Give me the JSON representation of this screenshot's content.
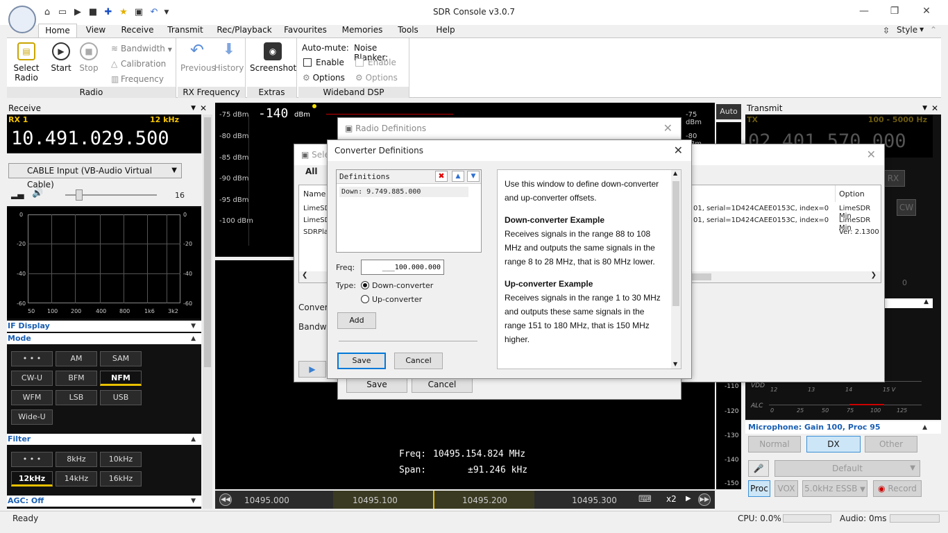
{
  "app": {
    "title": "SDR Console v3.0.7",
    "window_controls": [
      "—",
      "❐",
      "✕"
    ]
  },
  "ribbon": {
    "tabs": [
      "Home",
      "View",
      "Receive",
      "Transmit",
      "Rec/Playback",
      "Favourites",
      "Memories",
      "Tools",
      "Help"
    ],
    "active_tab": "Home",
    "style_label": "Style",
    "radio_group": {
      "label": "Radio",
      "select_radio": "Select Radio",
      "start": "Start",
      "stop": "Stop",
      "bandwidth": "Bandwidth",
      "calibration": "Calibration",
      "frequency": "Frequency"
    },
    "rx_frequency_group": {
      "label": "RX Frequency",
      "previous": "Previous",
      "history": "History"
    },
    "extras_group": {
      "label": "Extras",
      "screenshot": "Screenshot"
    },
    "wideband_group": {
      "label": "Wideband DSP",
      "auto_mute": "Auto-mute:",
      "noise_blanker": "Noise Blanker:",
      "enable": "Enable",
      "options": "Options"
    }
  },
  "receive": {
    "header": "Receive",
    "rx_label": "RX 1",
    "bandwidth": "12 kHz",
    "frequency": "10.491.029.500",
    "audio_device": "CABLE Input (VB-Audio Virtual Cable)",
    "volume_value": "16",
    "volume_level": 0.15,
    "graph_y_left": [
      "0",
      "-20",
      "-40",
      "-60"
    ],
    "graph_y_right": [
      "0",
      "-20",
      "-40",
      "-60"
    ],
    "graph_x": [
      "50",
      "100",
      "200",
      "400",
      "800",
      "1k6",
      "3k2"
    ],
    "if_display": "IF Display",
    "mode_header": "Mode",
    "modes": [
      "• • •",
      "AM",
      "SAM",
      "CW-U",
      "BFM",
      "NFM",
      "WFM",
      "LSB",
      "USB",
      "Wide-U"
    ],
    "active_mode": "NFM",
    "filter_header": "Filter",
    "filters": [
      "• • •",
      "8kHz",
      "10kHz",
      "12kHz",
      "14kHz",
      "16kHz"
    ],
    "active_filter": "12kHz",
    "agc": "AGC: Off"
  },
  "spectrum": {
    "level": "-140",
    "level_unit": "dBm",
    "dbm_left": [
      "-75 dBm",
      "-80 dBm",
      "-85 dBm",
      "-90 dBm",
      "-95 dBm",
      "-100 dBm"
    ],
    "dbm_right": [
      "-75 dBm",
      "-80 dBm"
    ],
    "auto": "Auto",
    "right_scale": [
      "-110",
      "-120",
      "-130",
      "-140",
      "-150"
    ],
    "freq_readout_label": "Freq:",
    "freq_readout": "10495.154.824 MHz",
    "span_label": "Span:",
    "span_readout": "±91.246 kHz",
    "scale_labels": [
      "10495.000",
      "10495.100",
      "10495.200",
      "10495.300"
    ],
    "zoom": "x2"
  },
  "transmit": {
    "header": "Transmit",
    "tx_label": "TX",
    "range": "100 - 5000 Hz",
    "frequency": "02.401.570.000",
    "rx_btn": "RX",
    "cw_btn": "CW",
    "meter_zero": "0",
    "vdd_label": "VDD",
    "vdd_scale": [
      "12",
      "13",
      "14",
      "15 V"
    ],
    "alc_label": "ALC",
    "alc_scale": [
      "0",
      "25",
      "50",
      "75",
      "100",
      "125"
    ],
    "mic_header": "Microphone: Gain 100, Proc 95",
    "mic_modes": [
      "Normal",
      "DX",
      "Other"
    ],
    "active_mic_mode": "DX",
    "default": "Default",
    "proc": "Proc",
    "vox": "VOX",
    "essb": "5.0kHz ESSB",
    "record": "Record"
  },
  "status": {
    "ready": "Ready",
    "cpu": "CPU: 0.0%",
    "audio": "Audio: 0ms"
  },
  "select_dialog": {
    "title": "Sele",
    "tab_all": "All",
    "col_name": "Name",
    "col_option": "Option",
    "rows": [
      {
        "name": "LimeSDR",
        "detail": "01, serial=1D424CAEE0153C, index=0",
        "option": "LimeSDR Min"
      },
      {
        "name": "LimeSDR",
        "detail": "01, serial=1D424CAEE0153C, index=0",
        "option": "LimeSDR Min"
      },
      {
        "name": "SDRPla",
        "detail": "",
        "option": "Ver: 2.1300"
      }
    ],
    "converter_label": "Converte",
    "bandwidth_label": "Bandwidt"
  },
  "radio_dialog": {
    "title": "Radio Definitions",
    "save": "Save",
    "cancel": "Cancel"
  },
  "converter_dialog": {
    "title": "Converter Definitions",
    "definitions_header": "Definitions",
    "definitions": [
      "Down: 9.749.885.000"
    ],
    "freq_label": "Freq:",
    "freq_value": "___100.000.000",
    "type_label": "Type:",
    "type_down": "Down-converter",
    "type_up": "Up-converter",
    "add": "Add",
    "save": "Save",
    "cancel": "Cancel",
    "help_intro": "Use this window to define down-converter and up-converter offsets.",
    "help_down_title": "Down-converter Example",
    "help_down_text": "Receives signals in the range 88 to 108 MHz and outputs the same signals in the range 8 to 28 MHz, that is 80 MHz lower.",
    "help_up_title": "Up-converter Example",
    "help_up_text": "Receives signals in the range 1 to 30 MHz and outputs these same signals in the range 151 to 180 MHz, that is 150 MHz higher."
  },
  "colors": {
    "accent_blue": "#1a5fb4",
    "rx_yellow": "#f5c400",
    "focus_blue": "#0078d7"
  }
}
